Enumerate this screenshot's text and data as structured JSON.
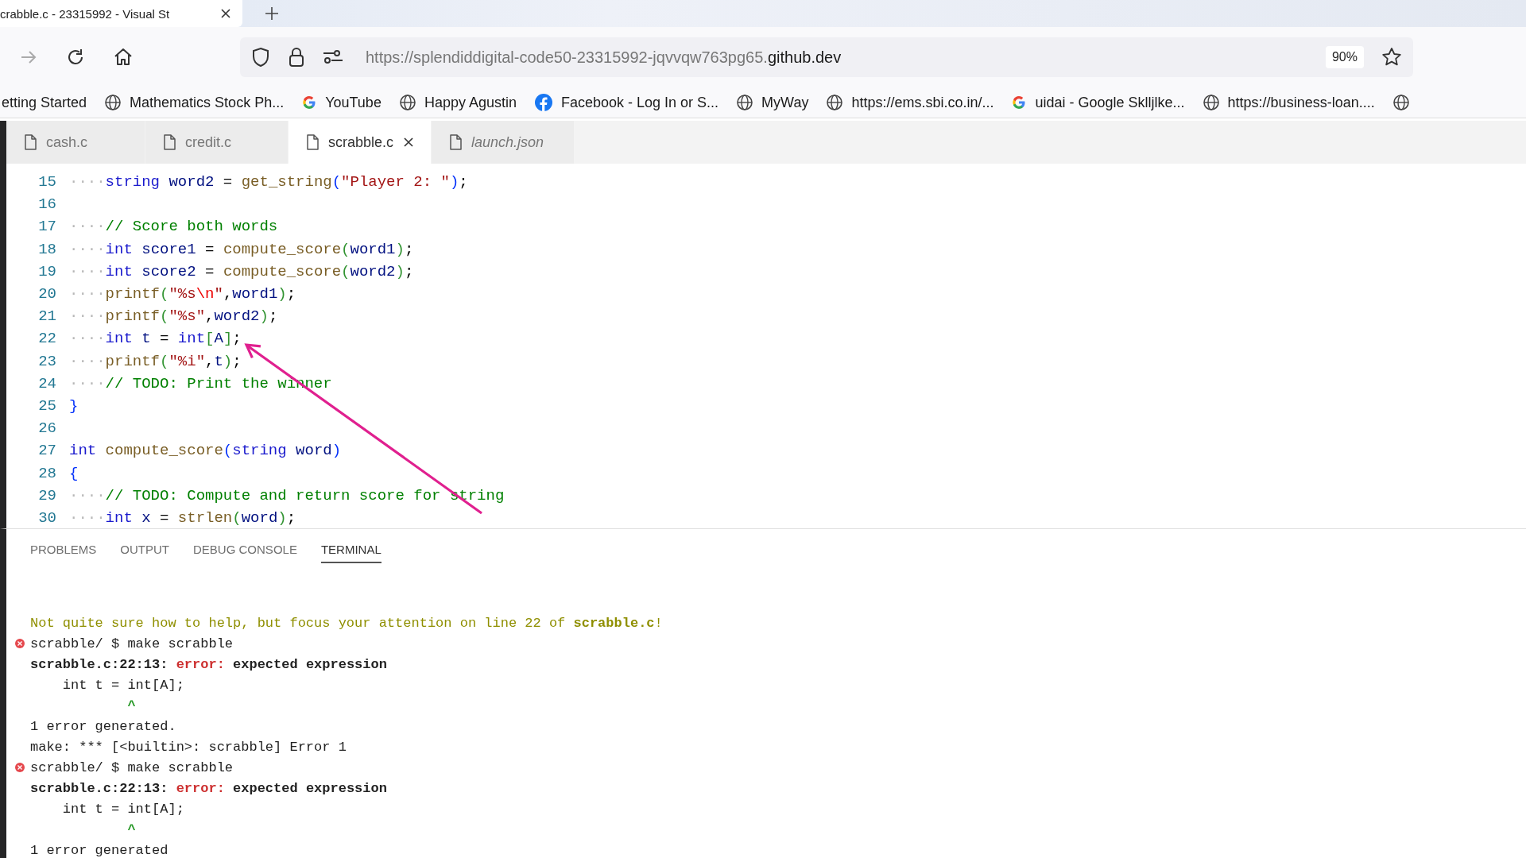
{
  "browser_tab": {
    "title": "crabble.c - 23315992 - Visual St"
  },
  "address_bar": {
    "url_prefix": "https://splendiddigital-code50-23315992-jqvvqw763pg65.",
    "url_domain": "github.dev",
    "zoom": "90%"
  },
  "bookmarks": [
    {
      "label": "etting Started"
    },
    {
      "label": "Mathematics Stock Ph...",
      "kind": "globe"
    },
    {
      "label": "YouTube",
      "kind": "google"
    },
    {
      "label": "Happy Agustin",
      "kind": "globe"
    },
    {
      "label": "Facebook - Log In or S...",
      "kind": "facebook"
    },
    {
      "label": "MyWay",
      "kind": "globe"
    },
    {
      "label": "https://ems.sbi.co.in/...",
      "kind": "globe"
    },
    {
      "label": "uidai - Google Sklljlke...",
      "kind": "google"
    },
    {
      "label": "https://business-loan....",
      "kind": "globe"
    },
    {
      "kind": "globe"
    }
  ],
  "editor_tabs": [
    {
      "label": "cash.c",
      "selected": false,
      "preview": false
    },
    {
      "label": "credit.c",
      "selected": false,
      "preview": false
    },
    {
      "label": "scrabble.c",
      "selected": true,
      "preview": false
    },
    {
      "label": "launch.json",
      "selected": false,
      "preview": true
    }
  ],
  "code_lines": [
    {
      "number": "15",
      "tokens": [
        {
          "kind": "ws",
          "text": "····"
        },
        {
          "kind": "kw",
          "text": "string"
        },
        {
          "kind": "var",
          "text": " word2"
        },
        {
          "kind": "p",
          "text": " = "
        },
        {
          "kind": "fn",
          "text": "get_string"
        },
        {
          "kind": "br1",
          "text": "("
        },
        {
          "kind": "str",
          "text": "\"Player 2: \""
        },
        {
          "kind": "br1",
          "text": ")"
        },
        {
          "kind": "p",
          "text": ";"
        }
      ]
    },
    {
      "number": "16"
    },
    {
      "number": "17",
      "tokens": [
        {
          "kind": "ws",
          "text": "····"
        },
        {
          "kind": "cm",
          "text": "// Score both words"
        }
      ]
    },
    {
      "number": "18",
      "tokens": [
        {
          "kind": "ws",
          "text": "····"
        },
        {
          "kind": "kw",
          "text": "int"
        },
        {
          "kind": "var",
          "text": " score1"
        },
        {
          "kind": "p",
          "text": " = "
        },
        {
          "kind": "fn",
          "text": "compute_score"
        },
        {
          "kind": "br2",
          "text": "("
        },
        {
          "kind": "var",
          "text": "word1"
        },
        {
          "kind": "br2",
          "text": ")"
        },
        {
          "kind": "p",
          "text": ";"
        }
      ]
    },
    {
      "number": "19",
      "tokens": [
        {
          "kind": "ws",
          "text": "····"
        },
        {
          "kind": "kw",
          "text": "int"
        },
        {
          "kind": "var",
          "text": " score2"
        },
        {
          "kind": "p",
          "text": " = "
        },
        {
          "kind": "fn",
          "text": "compute_score"
        },
        {
          "kind": "br2",
          "text": "("
        },
        {
          "kind": "var",
          "text": "word2"
        },
        {
          "kind": "br2",
          "text": ")"
        },
        {
          "kind": "p",
          "text": ";"
        }
      ]
    },
    {
      "number": "20",
      "tokens": [
        {
          "kind": "ws",
          "text": "····"
        },
        {
          "kind": "fn",
          "text": "printf"
        },
        {
          "kind": "br2",
          "text": "("
        },
        {
          "kind": "str",
          "text": "\"%s"
        },
        {
          "kind": "esc",
          "text": "\\n"
        },
        {
          "kind": "str",
          "text": "\""
        },
        {
          "kind": "p",
          "text": ","
        },
        {
          "kind": "var",
          "text": "word1"
        },
        {
          "kind": "br2",
          "text": ")"
        },
        {
          "kind": "p",
          "text": ";"
        }
      ]
    },
    {
      "number": "21",
      "tokens": [
        {
          "kind": "ws",
          "text": "····"
        },
        {
          "kind": "fn",
          "text": "printf"
        },
        {
          "kind": "br2",
          "text": "("
        },
        {
          "kind": "str",
          "text": "\"%s\""
        },
        {
          "kind": "p",
          "text": ","
        },
        {
          "kind": "var",
          "text": "word2"
        },
        {
          "kind": "br2",
          "text": ")"
        },
        {
          "kind": "p",
          "text": ";"
        }
      ]
    },
    {
      "number": "22",
      "tokens": [
        {
          "kind": "ws",
          "text": "····"
        },
        {
          "kind": "kw",
          "text": "int"
        },
        {
          "kind": "var",
          "text": " t"
        },
        {
          "kind": "p",
          "text": " = "
        },
        {
          "kind": "kw",
          "text": "int"
        },
        {
          "kind": "br2",
          "text": "["
        },
        {
          "kind": "var",
          "text": "A"
        },
        {
          "kind": "br2",
          "text": "]"
        },
        {
          "kind": "p",
          "text": ";"
        }
      ]
    },
    {
      "number": "23",
      "tokens": [
        {
          "kind": "ws",
          "text": "····"
        },
        {
          "kind": "fn",
          "text": "printf"
        },
        {
          "kind": "br2",
          "text": "("
        },
        {
          "kind": "str",
          "text": "\"%i\""
        },
        {
          "kind": "p",
          "text": ","
        },
        {
          "kind": "var",
          "text": "t"
        },
        {
          "kind": "br2",
          "text": ")"
        },
        {
          "kind": "p",
          "text": ";"
        }
      ]
    },
    {
      "number": "24",
      "tokens": [
        {
          "kind": "ws",
          "text": "····"
        },
        {
          "kind": "cm",
          "text": "// TODO: Print the winner"
        }
      ]
    },
    {
      "number": "25",
      "tokens": [
        {
          "kind": "br1",
          "text": "}"
        }
      ]
    },
    {
      "number": "26"
    },
    {
      "number": "27",
      "tokens": [
        {
          "kind": "kw",
          "text": "int"
        },
        {
          "kind": "fn",
          "text": " compute_score"
        },
        {
          "kind": "br1",
          "text": "("
        },
        {
          "kind": "kw",
          "text": "string"
        },
        {
          "kind": "var",
          "text": " word"
        },
        {
          "kind": "br1",
          "text": ")"
        }
      ]
    },
    {
      "number": "28",
      "tokens": [
        {
          "kind": "br1",
          "text": "{"
        }
      ]
    },
    {
      "number": "29",
      "tokens": [
        {
          "kind": "ws",
          "text": "····"
        },
        {
          "kind": "cm",
          "text": "// TODO: Compute and return score for string"
        }
      ]
    },
    {
      "number": "30",
      "tokens": [
        {
          "kind": "ws",
          "text": "····"
        },
        {
          "kind": "kw",
          "text": "int"
        },
        {
          "kind": "var",
          "text": " x"
        },
        {
          "kind": "p",
          "text": " = "
        },
        {
          "kind": "fn",
          "text": "strlen"
        },
        {
          "kind": "br2",
          "text": "("
        },
        {
          "kind": "var",
          "text": "word"
        },
        {
          "kind": "br2",
          "text": ")"
        },
        {
          "kind": "p",
          "text": ";"
        }
      ]
    }
  ],
  "panel_tabs": [
    {
      "label": "PROBLEMS",
      "selected": false
    },
    {
      "label": "OUTPUT",
      "selected": false
    },
    {
      "label": "DEBUG CONSOLE",
      "selected": false
    },
    {
      "label": "TERMINAL",
      "selected": true
    }
  ],
  "terminal_lines": [
    {
      "kind": "message",
      "tokens": [
        {
          "kind": "hint",
          "text": "Not quite sure how to help, but focus your attention on line 22 of "
        },
        {
          "kind": "hintb",
          "text": "scrabble.c"
        },
        {
          "kind": "hint",
          "text": "!"
        }
      ]
    },
    {
      "kind": "prompt",
      "failed": true,
      "tokens": [
        {
          "kind": "t",
          "text": "scrabble/ $ make scrabble"
        }
      ]
    },
    {
      "kind": "output",
      "tokens": [
        {
          "kind": "b",
          "text": "scrabble.c:22:13: "
        },
        {
          "kind": "err",
          "text": "error:"
        },
        {
          "kind": "b",
          "text": " expected expression"
        }
      ]
    },
    {
      "kind": "output",
      "tokens": [
        {
          "kind": "t",
          "text": "    int t = int[A];"
        }
      ]
    },
    {
      "kind": "output",
      "tokens": [
        {
          "kind": "caret",
          "text": "            ^"
        }
      ]
    },
    {
      "kind": "output",
      "tokens": [
        {
          "kind": "t",
          "text": "1 error generated."
        }
      ]
    },
    {
      "kind": "output",
      "tokens": [
        {
          "kind": "t",
          "text": "make: *** [<builtin>: scrabble] Error 1"
        }
      ]
    },
    {
      "kind": "prompt",
      "failed": true,
      "tokens": [
        {
          "kind": "t",
          "text": "scrabble/ $ make scrabble"
        }
      ]
    },
    {
      "kind": "output",
      "tokens": [
        {
          "kind": "b",
          "text": "scrabble.c:22:13: "
        },
        {
          "kind": "err",
          "text": "error:"
        },
        {
          "kind": "b",
          "text": " expected expression"
        }
      ]
    },
    {
      "kind": "output",
      "tokens": [
        {
          "kind": "t",
          "text": "    int t = int[A];"
        }
      ]
    },
    {
      "kind": "output",
      "tokens": [
        {
          "kind": "caret",
          "text": "            ^"
        }
      ]
    },
    {
      "kind": "output",
      "tokens": [
        {
          "kind": "t",
          "text": "1 error generated"
        }
      ]
    }
  ]
}
